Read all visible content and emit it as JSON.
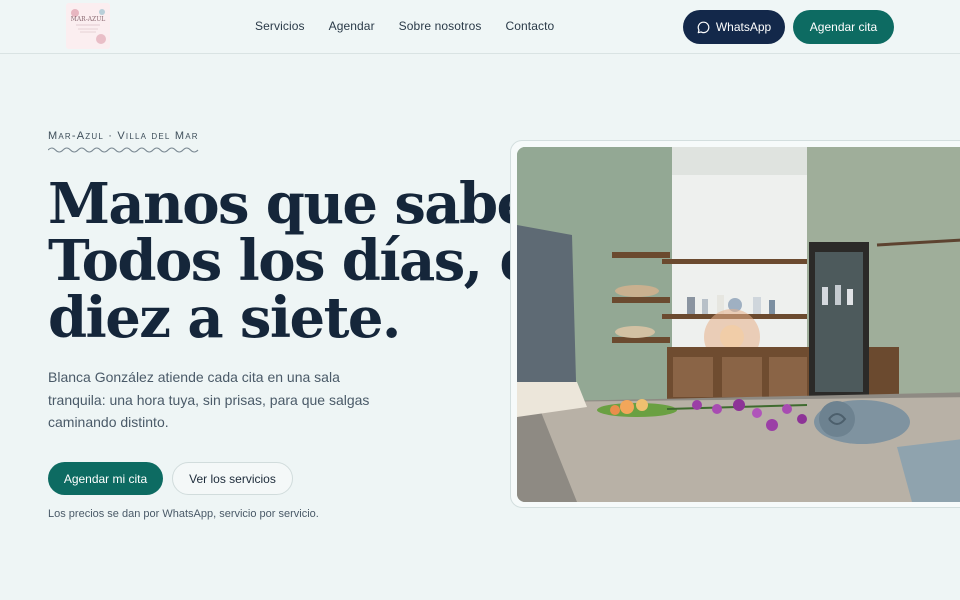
{
  "logo": {
    "text": "MAR-AZUL"
  },
  "nav": {
    "links": [
      "Servicios",
      "Agendar",
      "Sobre nosotros",
      "Contacto"
    ],
    "whatsapp_label": "WhatsApp",
    "cta_label": "Agendar cita"
  },
  "hero": {
    "eyebrow": "Mar-Azul · Villa del Mar",
    "headline": [
      "Manos que saben.",
      "Todos los días, de",
      "diez a siete."
    ],
    "lead": "Blanca González atiende cada cita en una sala tranquila: una hora tuya, sin prisas, para que salgas caminando distinto.",
    "primary_button": "Agendar mi cita",
    "secondary_button": "Ver los servicios",
    "note": "Los precios se dan por WhatsApp, servicio por servicio."
  },
  "colors": {
    "brand": "#0d6b62",
    "navy": "#13284a",
    "background": "#eef5f5"
  },
  "icons": {
    "whatsapp": "chat-bubble-icon"
  }
}
